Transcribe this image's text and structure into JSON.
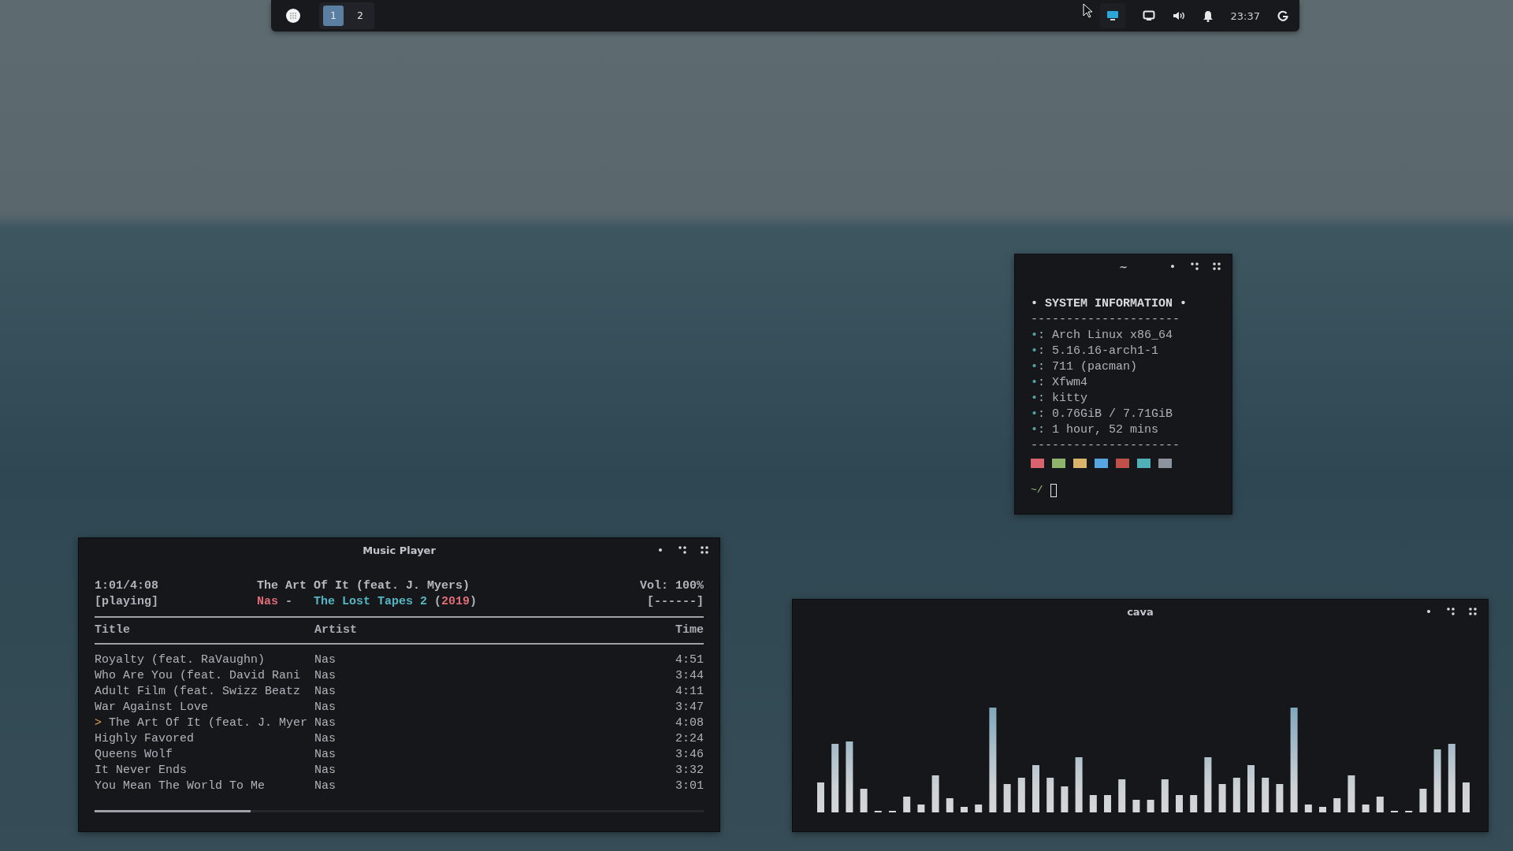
{
  "top_bar": {
    "workspaces": [
      {
        "label": "1",
        "selected": true
      },
      {
        "label": "2",
        "selected": false
      }
    ],
    "clock": "23:37"
  },
  "terminal": {
    "title": "~",
    "heading": "• SYSTEM INFORMATION •",
    "rule": "---------------------",
    "lines": [
      {
        "bullet": "•",
        "text": ": Arch Linux x86_64"
      },
      {
        "bullet": "•",
        "text": ": 5.16.16-arch1-1"
      },
      {
        "bullet": "•",
        "text": ": 711 (pacman)"
      },
      {
        "bullet": "•",
        "text": ": Xfwm4"
      },
      {
        "bullet": "•",
        "text": ": kitty"
      },
      {
        "bullet": "•",
        "text": ": 0.76GiB / 7.71GiB"
      },
      {
        "bullet": "•",
        "text": ": 1 hour, 52 mins"
      }
    ],
    "swatches": [
      {
        "color": "#d9626f"
      },
      {
        "color": "#8fb36b"
      },
      {
        "color": "#d9b46a"
      },
      {
        "color": "#56a4e0"
      },
      {
        "color": "#c0504a"
      },
      {
        "color": "#4fb0b8"
      },
      {
        "color": "#8d939c"
      }
    ],
    "prompt": "~/"
  },
  "music_player": {
    "title": "Music Player",
    "elapsed": "1:01/4:08",
    "state": "[playing]",
    "song": "The Art Of It (feat. J. Myers)",
    "details": [
      {
        "kind": "artist",
        "text": "Nas"
      },
      {
        "kind": "plain",
        "text": "-"
      },
      {
        "kind": "album",
        "text": "The Lost Tapes 2"
      },
      {
        "kind": "plain",
        "text": "("
      },
      {
        "kind": "year",
        "text": "2019"
      },
      {
        "kind": "plain",
        "text": ")"
      }
    ],
    "volume": "Vol: 100%",
    "volume_bar": "[------]",
    "columns": [
      "Title",
      "Artist",
      "Time"
    ],
    "playing_marker": ">",
    "rows": [
      {
        "title": "Royalty (feat. RaVaughn)",
        "artist": "Nas",
        "time": "4:51",
        "playing": false
      },
      {
        "title": "Who Are You (feat. David Rani",
        "artist": "Nas",
        "time": "3:44",
        "playing": false
      },
      {
        "title": "Adult Film (feat. Swizz Beatz",
        "artist": "Nas",
        "time": "4:11",
        "playing": false
      },
      {
        "title": "War Against Love",
        "artist": "Nas",
        "time": "3:47",
        "playing": false
      },
      {
        "title": "The Art Of It (feat. J. Myer",
        "artist": "Nas",
        "time": "4:08",
        "playing": true
      },
      {
        "title": "Highly Favored",
        "artist": "Nas",
        "time": "2:24",
        "playing": false
      },
      {
        "title": "Queens Wolf",
        "artist": "Nas",
        "time": "3:46",
        "playing": false
      },
      {
        "title": "It Never Ends",
        "artist": "Nas",
        "time": "3:32",
        "playing": false
      },
      {
        "title": "You Mean The World To Me",
        "artist": "Nas",
        "time": "3:01",
        "playing": false
      }
    ],
    "progress": {
      "level": 0.256
    }
  },
  "cava": {
    "title": "cava"
  }
}
